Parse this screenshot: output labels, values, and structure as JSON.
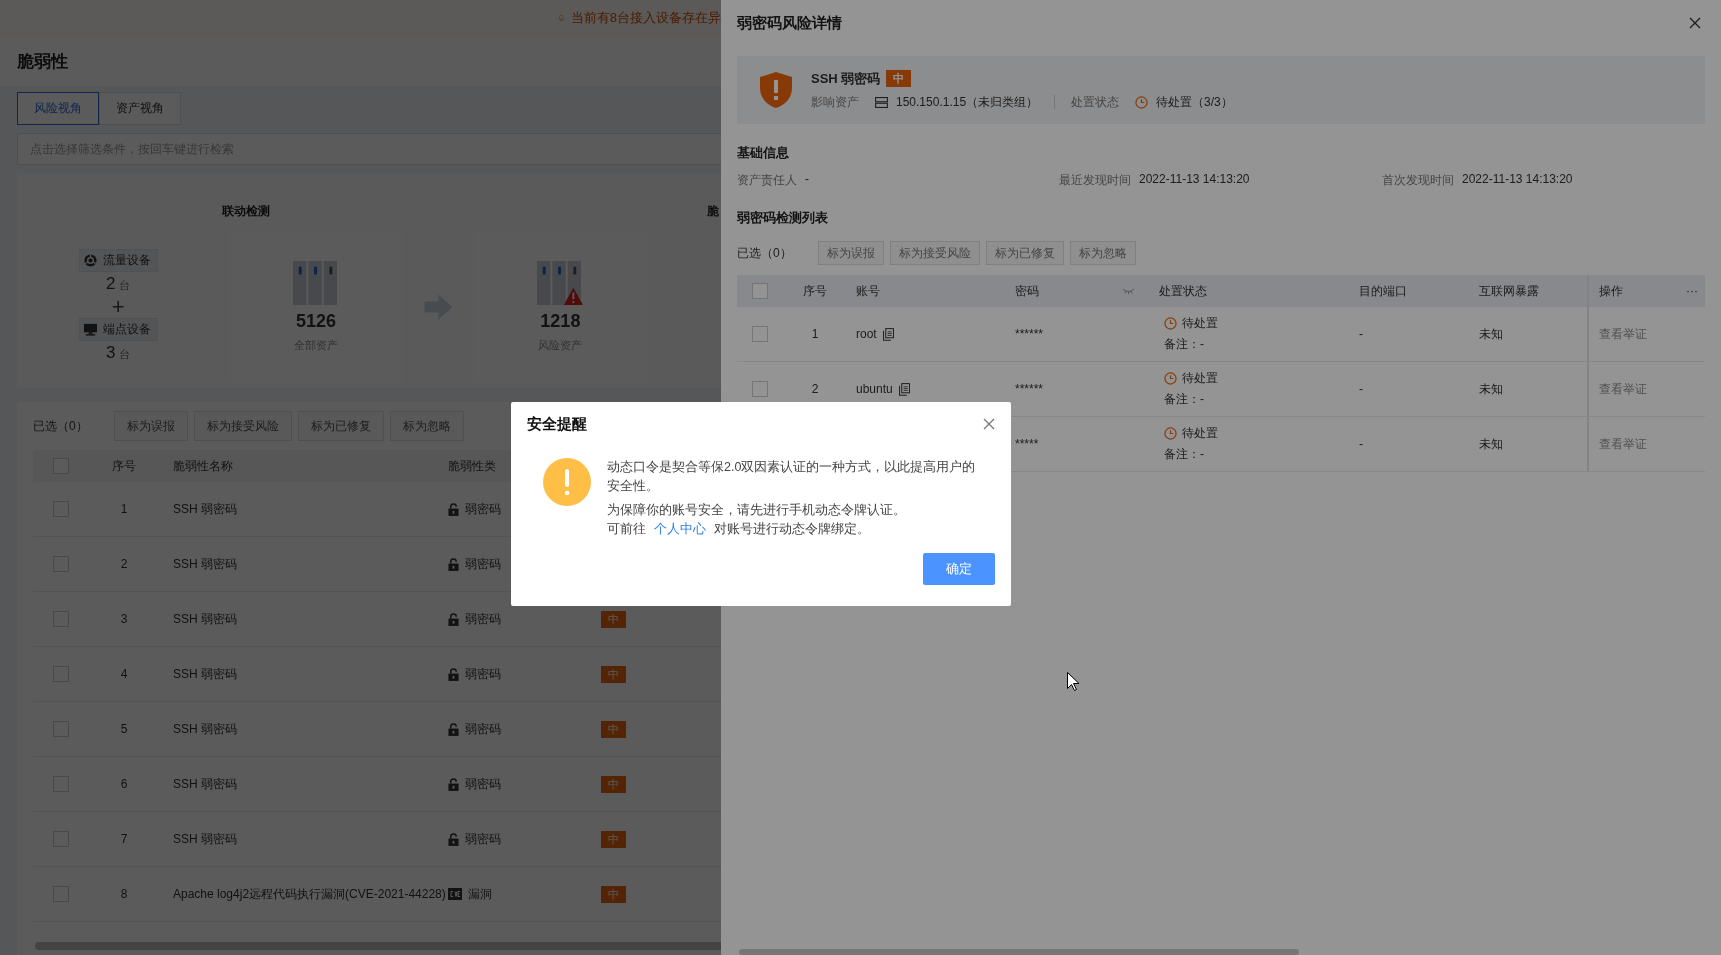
{
  "banner": {
    "text": "当前有8台接入设备存在异"
  },
  "page": {
    "title": "脆弱性",
    "tabs": [
      {
        "label": "风险视角",
        "selected": true
      },
      {
        "label": "资产视角",
        "selected": false
      }
    ],
    "search": {
      "placeholder": "点击选择筛选条件，按回车键进行检索"
    },
    "stats": {
      "section_title": "联动检测",
      "devices": [
        {
          "label": "流量设备",
          "count": "2",
          "unit": "台",
          "kind": "traffic"
        },
        {
          "label": "端点设备",
          "count": "3",
          "unit": "台",
          "kind": "endpoint"
        }
      ],
      "plus": "+",
      "cards": [
        {
          "value": "5126",
          "label": "全部资产",
          "kind": "all"
        },
        {
          "value": "1218",
          "label": "风险资产",
          "kind": "risk"
        }
      ],
      "next_title": "脆"
    },
    "selected_label": "已选（0）",
    "actions": [
      {
        "label": "标为误报",
        "disabled": true
      },
      {
        "label": "标为接受风险",
        "disabled": true
      },
      {
        "label": "标为已修复",
        "disabled": true
      },
      {
        "label": "标为忽略",
        "disabled": true
      }
    ],
    "table": {
      "header_checked": false,
      "columns": [
        "序号",
        "脆弱性名称",
        "脆弱性类"
      ],
      "rows": [
        {
          "checked": false,
          "index": "1",
          "name": "SSH 弱密码",
          "kind": "password",
          "type": "弱密码"
        },
        {
          "checked": false,
          "index": "2",
          "name": "SSH 弱密码",
          "kind": "password",
          "type": "弱密码"
        },
        {
          "checked": false,
          "index": "3",
          "name": "SSH 弱密码",
          "kind": "password",
          "type": "弱密码",
          "level": "中"
        },
        {
          "checked": false,
          "index": "4",
          "name": "SSH 弱密码",
          "kind": "password",
          "type": "弱密码",
          "level": "中"
        },
        {
          "checked": false,
          "index": "5",
          "name": "SSH 弱密码",
          "kind": "password",
          "type": "弱密码",
          "level": "中"
        },
        {
          "checked": false,
          "index": "6",
          "name": "SSH 弱密码",
          "kind": "password",
          "type": "弱密码",
          "level": "中"
        },
        {
          "checked": false,
          "index": "7",
          "name": "SSH 弱密码",
          "kind": "password",
          "type": "弱密码",
          "level": "中"
        },
        {
          "checked": false,
          "index": "8",
          "name": "Apache log4j2远程代码执行漏洞(CVE-2021-44228)",
          "kind": "vulnerability",
          "type": "漏洞",
          "level": "中"
        }
      ]
    }
  },
  "drawer": {
    "title": "弱密码风险详情",
    "summary": {
      "name": "SSH 弱密码",
      "level": "中",
      "asset_label": "影响资产",
      "asset": "150.150.1.15（未归类组）",
      "status_label": "处置状态",
      "status": "待处置（3/3）"
    },
    "basic_title": "基础信息",
    "basic": [
      {
        "label": "资产责任人",
        "value": "-"
      },
      {
        "label": "最近发现时间",
        "value": "2022-11-13 14:13:20"
      },
      {
        "label": "首次发现时间",
        "value": "2022-11-13 14:13:20"
      }
    ],
    "list_title": "弱密码检测列表",
    "selected_label": "已选（0）",
    "actions": [
      {
        "label": "标为误报",
        "disabled": true
      },
      {
        "label": "标为接受风险",
        "disabled": true
      },
      {
        "label": "标为已修复",
        "disabled": true
      },
      {
        "label": "标为忽略",
        "disabled": true
      }
    ],
    "table": {
      "header_checked": false,
      "columns": [
        "序号",
        "账号",
        "密码",
        "处置状态",
        "目的端口",
        "互联网暴露",
        "操作"
      ],
      "more": "···",
      "rows": [
        {
          "checked": false,
          "index": "1",
          "account": "root",
          "password": "******",
          "status": "待处置",
          "note": "备注：-",
          "port": "-",
          "exposure": "未知",
          "action": "查看举证",
          "action_disabled": true
        },
        {
          "checked": false,
          "index": "2",
          "account": "ubuntu",
          "password": "******",
          "status": "待处置",
          "note": "备注：-",
          "port": "-",
          "exposure": "未知",
          "action": "查看举证",
          "action_disabled": true
        },
        {
          "password": "*****",
          "status": "待处置",
          "note": "备注：-",
          "port": "-",
          "exposure": "未知",
          "action": "查看举证",
          "action_disabled": true
        }
      ]
    }
  },
  "dialog": {
    "title": "安全提醒",
    "paragraphs": [
      "动态口令是契合等保2.0双因素认证的一种方式，以此提高用户的安全性。"
    ],
    "line1": "为保障你的账号安全，请先进行手机动态令牌认证。",
    "line2_before": "可前往",
    "link": "个人中心",
    "line2_after": "对账号进行动态令牌绑定。",
    "button": "确定"
  }
}
